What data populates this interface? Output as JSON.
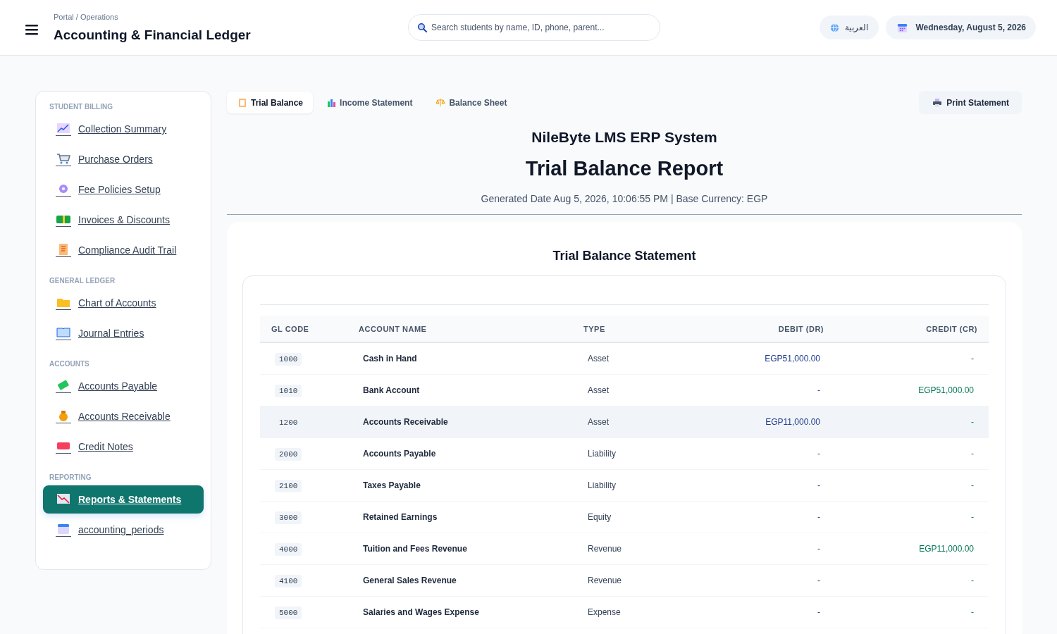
{
  "header": {
    "breadcrumb": "Portal / Operations",
    "title": "Accounting & Financial Ledger",
    "search": {
      "placeholder": "Search students by name, ID, phone, parent..."
    },
    "language": "العربية",
    "date": "Wednesday, August 5, 2026"
  },
  "sidebar": {
    "sections": [
      {
        "title": "STUDENT BILLING",
        "items": [
          {
            "label": "Collection Summary",
            "selected": false
          },
          {
            "label": "Purchase Orders",
            "selected": false
          },
          {
            "label": "Fee Policies Setup",
            "selected": false
          },
          {
            "label": "Invoices & Discounts",
            "selected": false
          },
          {
            "label": "Compliance Audit Trail",
            "selected": false
          }
        ]
      },
      {
        "title": "GENERAL LEDGER",
        "items": [
          {
            "label": "Chart of Accounts",
            "selected": false
          },
          {
            "label": "Journal Entries",
            "selected": false
          }
        ]
      },
      {
        "title": "ACCOUNTS",
        "items": [
          {
            "label": "Accounts Payable",
            "selected": false
          },
          {
            "label": "Accounts Receivable",
            "selected": false
          },
          {
            "label": "Credit Notes",
            "selected": false
          }
        ]
      },
      {
        "title": "REPORTING",
        "items": [
          {
            "label": "Reports & Statements",
            "selected": true
          },
          {
            "label": "accounting_periods",
            "selected": false
          }
        ]
      }
    ]
  },
  "tabs": [
    {
      "label": "Trial Balance",
      "selected": true
    },
    {
      "label": "Income Statement",
      "selected": false
    },
    {
      "label": "Balance Sheet",
      "selected": false
    }
  ],
  "print_button": "Print Statement",
  "report": {
    "company": "NileByte LMS ERP System",
    "title": "Trial Balance Report",
    "meta": "Generated Date Aug 5, 2026, 10:06:55 PM | Base Currency: EGP",
    "card_title": "Trial Balance Statement"
  },
  "table": {
    "columns": [
      "GL CODE",
      "ACCOUNT NAME",
      "TYPE",
      "DEBIT (DR)",
      "CREDIT (CR)"
    ],
    "rows": [
      {
        "code": "1000",
        "name": "Cash in Hand",
        "type": "Asset",
        "debit": "EGP51,000.00",
        "credit": "-",
        "selected": false
      },
      {
        "code": "1010",
        "name": "Bank Account",
        "type": "Asset",
        "debit": "-",
        "credit": "EGP51,000.00",
        "selected": false
      },
      {
        "code": "1200",
        "name": "Accounts Receivable",
        "type": "Asset",
        "debit": "EGP11,000.00",
        "credit": "-",
        "selected": true
      },
      {
        "code": "2000",
        "name": "Accounts Payable",
        "type": "Liability",
        "debit": "-",
        "credit": "-",
        "selected": false
      },
      {
        "code": "2100",
        "name": "Taxes Payable",
        "type": "Liability",
        "debit": "-",
        "credit": "-",
        "selected": false
      },
      {
        "code": "3000",
        "name": "Retained Earnings",
        "type": "Equity",
        "debit": "-",
        "credit": "-",
        "selected": false
      },
      {
        "code": "4000",
        "name": "Tuition and Fees Revenue",
        "type": "Revenue",
        "debit": "-",
        "credit": "EGP11,000.00",
        "selected": false
      },
      {
        "code": "4100",
        "name": "General Sales Revenue",
        "type": "Revenue",
        "debit": "-",
        "credit": "-",
        "selected": false
      },
      {
        "code": "5000",
        "name": "Salaries and Wages Expense",
        "type": "Expense",
        "debit": "-",
        "credit": "-",
        "selected": false
      }
    ]
  }
}
